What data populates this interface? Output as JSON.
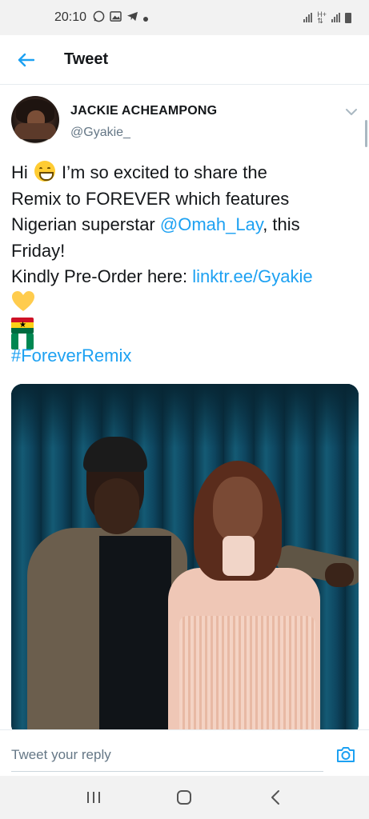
{
  "status_bar": {
    "time": "20:10",
    "left_icons": [
      "whatsapp-icon",
      "gallery-icon",
      "telegram-icon",
      "dot-icon"
    ],
    "right_icons": [
      "signal-icon",
      "mobile-data-icon",
      "signal-icon",
      "battery-icon"
    ]
  },
  "app_bar": {
    "title": "Tweet",
    "back_icon": "arrow-left-icon"
  },
  "tweet": {
    "author_name": "JACKIE ACHEAMPONG",
    "author_handle": "@Gyakie_",
    "text": {
      "line1_a": "Hi",
      "line1_b": "I’m so excited to share the",
      "line2": "Remix to FOREVER which features",
      "line3_a": "Nigerian superstar ",
      "line3_mention": "@Omah_Lay",
      "line3_b": ", this",
      "line4": "Friday!",
      "line5_a": "Kindly Pre-Order here: ",
      "line5_link": "linktr.ee/Gyakie",
      "hashtag": "#ForeverRemix"
    },
    "emojis": [
      "grinning-squinting-face",
      "yellow-heart",
      "flag-ghana",
      "flag-nigeria"
    ]
  },
  "reply": {
    "placeholder": "Tweet your reply",
    "camera_icon": "camera-icon"
  },
  "nav_bar": {
    "buttons": [
      "recent-apps-icon",
      "home-icon",
      "back-icon"
    ]
  },
  "colors": {
    "accent": "#1da1f2",
    "text": "#14171a",
    "secondary": "#657786",
    "ghana_red": "#ce1126",
    "ghana_gold": "#fcd116",
    "ghana_green": "#006b3f",
    "nigeria_green": "#008751"
  }
}
